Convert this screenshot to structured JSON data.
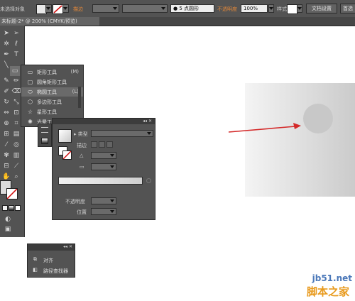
{
  "control_bar": {
    "selection_label": "未选择对象",
    "stroke_label": "描边",
    "stroke_value": "",
    "profile_value": "",
    "brush_value": "5 点圆形",
    "opacity_label": "不透明度",
    "opacity_value": "100%",
    "style_label": "样式",
    "doc_setup_label": "文档设置",
    "prefs_label": "首选"
  },
  "document_tab": {
    "title": "未标题-2* @ 200% (CMYK/预览)"
  },
  "tool_flyout": {
    "items": [
      {
        "icon": "rectangle-icon",
        "glyph": "▭",
        "label": "矩形工具",
        "shortcut": "(M)",
        "selected": false
      },
      {
        "icon": "rounded-rectangle-icon",
        "glyph": "▢",
        "label": "圆角矩形工具",
        "shortcut": "",
        "selected": false
      },
      {
        "icon": "ellipse-icon",
        "glyph": "⬭",
        "label": "椭圆工具",
        "shortcut": "(L)",
        "selected": true
      },
      {
        "icon": "polygon-icon",
        "glyph": "⬡",
        "label": "多边形工具",
        "shortcut": "",
        "selected": false
      },
      {
        "icon": "star-icon",
        "glyph": "☆",
        "label": "星形工具",
        "shortcut": "",
        "selected": false
      },
      {
        "icon": "flare-icon",
        "glyph": "✺",
        "label": "光晕工具",
        "shortcut": "",
        "selected": false
      }
    ]
  },
  "gradient_panel": {
    "type_label": "类型",
    "stroke_label": "描边",
    "angle_label": "△",
    "aspect_label": "▭",
    "opacity_label": "不透明度",
    "location_label": "位置",
    "controls": "◂◂  ✕"
  },
  "align_panel": {
    "items": [
      {
        "icon": "align-icon",
        "glyph": "⧉",
        "label": "对齐"
      },
      {
        "icon": "pathfinder-icon",
        "glyph": "◧",
        "label": "路径查找器"
      }
    ],
    "controls": "◂◂ ✕"
  },
  "watermark": {
    "site": "jb51.net",
    "name": "脚本之家"
  },
  "colors": {
    "ui_panel": "#535353",
    "arrow": "#d42a2a",
    "watermark_blue": "#4b78b9",
    "watermark_orange": "#e89a1d"
  }
}
